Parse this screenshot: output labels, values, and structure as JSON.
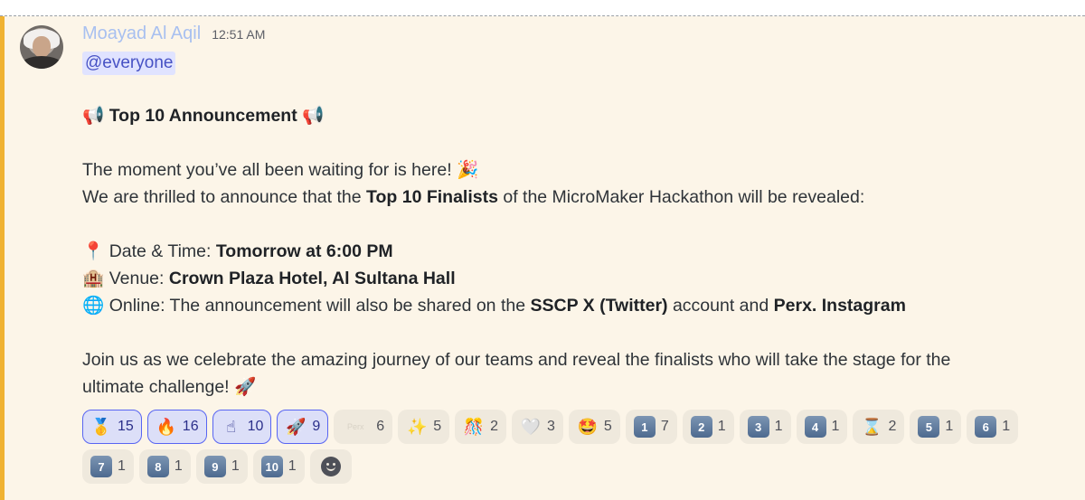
{
  "message": {
    "author": "Moayad Al Aqil",
    "timestamp": "12:51 AM",
    "mention": "@everyone",
    "announcement_icon": "📢",
    "announcement_title": "Top 10 Announcement",
    "line1": "The moment you’ve all been waiting for is here!",
    "line1_emoji": "🎉",
    "line2_pre": "We are thrilled to announce that the ",
    "line2_bold": "Top 10 Finalists",
    "line2_post": " of the MicroMaker Hackathon will be revealed:",
    "date_icon": "📍",
    "date_label": "Date & Time: ",
    "date_value": "Tomorrow at 6:00 PM",
    "venue_icon": "🏨",
    "venue_label": "Venue: ",
    "venue_value": "Crown Plaza Hotel, Al Sultana Hall",
    "online_icon": "🌐",
    "online_label": "Online: The announcement will also be shared on the ",
    "online_bold1": "SSCP X (Twitter)",
    "online_mid": " account and ",
    "online_bold2": "Perx. Instagram",
    "closing1": "Join us as we celebrate the amazing journey of our teams and reveal the finalists who will take the stage for the",
    "closing2": "ultimate challenge!",
    "closing_emoji": "🚀"
  },
  "reactions": [
    {
      "emoji": "🥇",
      "count": "15",
      "me": true
    },
    {
      "emoji": "🔥",
      "count": "16",
      "me": true
    },
    {
      "emoji": "☝",
      "count": "10",
      "me": true
    },
    {
      "emoji": "🚀",
      "count": "9",
      "me": true
    },
    {
      "emoji": "Perx",
      "count": "6",
      "me": false,
      "custom": true
    },
    {
      "emoji": "✨",
      "count": "5",
      "me": false
    },
    {
      "emoji": "🎊",
      "count": "2",
      "me": false
    },
    {
      "emoji": "🤍",
      "count": "3",
      "me": false
    },
    {
      "emoji": "🤩",
      "count": "5",
      "me": false
    },
    {
      "keycap": "1",
      "count": "7"
    },
    {
      "keycap": "2",
      "count": "1"
    },
    {
      "keycap": "3",
      "count": "1"
    },
    {
      "keycap": "4",
      "count": "1"
    },
    {
      "emoji": "⌛",
      "count": "2",
      "me": false
    },
    {
      "keycap": "5",
      "count": "1"
    },
    {
      "keycap": "6",
      "count": "1"
    },
    {
      "keycap": "7",
      "count": "1"
    },
    {
      "keycap": "8",
      "count": "1"
    },
    {
      "keycap": "9",
      "count": "1"
    },
    {
      "keycap": "10",
      "count": "1"
    }
  ],
  "add_reaction_icon": "smiley-icon"
}
